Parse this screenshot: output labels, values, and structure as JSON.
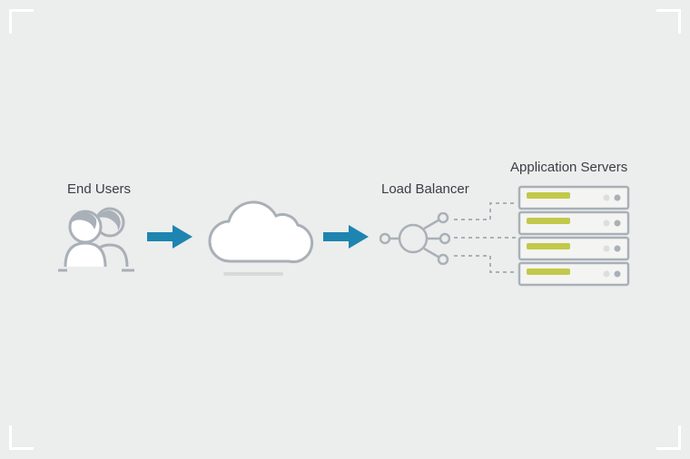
{
  "labels": {
    "end_users": "End Users",
    "load_balancer": "Load Balancer",
    "app_servers": "Application Servers"
  },
  "colors": {
    "accent": "#1d85af",
    "stroke": "#a9b0b7",
    "server_indicator": "#c2c94a",
    "server_body": "#f4f4f2",
    "text": "#3a3f44"
  }
}
